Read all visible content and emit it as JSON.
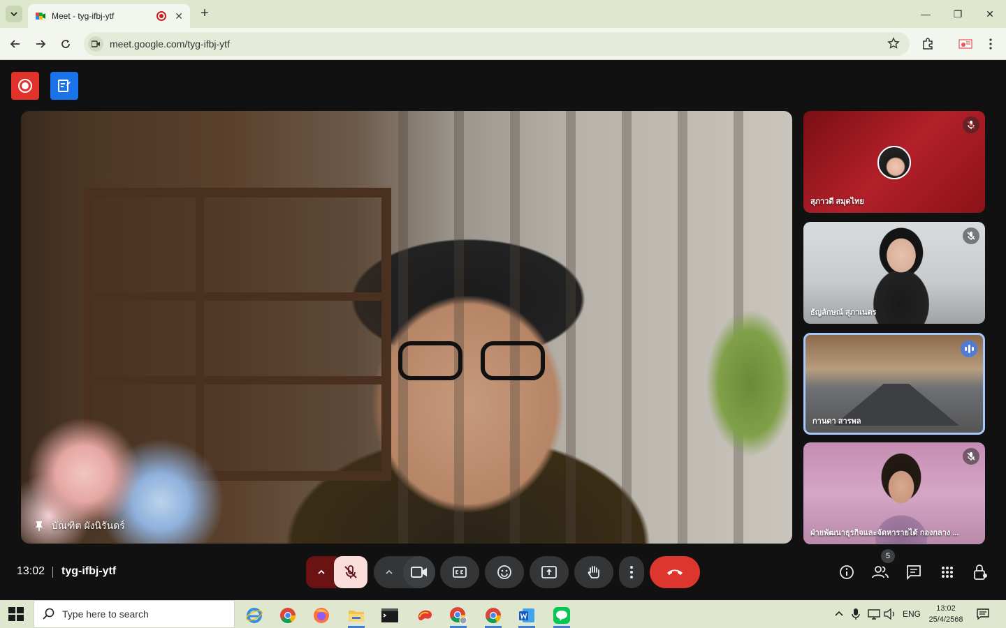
{
  "browser": {
    "tab_title": "Meet - tyg-ifbj-ytf",
    "tab_close": "✕",
    "new_tab": "+",
    "url": "meet.google.com/tyg-ifbj-ytf",
    "window_controls": {
      "minimize": "—",
      "maximize": "❐",
      "close": "✕"
    }
  },
  "meeting": {
    "time": "13:02",
    "code": "tyg-ifbj-ytf",
    "main_speaker": "บัณฑิต ผังนิรันดร์",
    "participants_count": "5",
    "tiles": [
      {
        "name": "สุภาวดี สมุดไทย",
        "state": "muted"
      },
      {
        "name": "ธัญลักษณ์ สุภาเนตร",
        "state": "muted"
      },
      {
        "name": "กานดา สารพล",
        "state": "speaking"
      },
      {
        "name": "ฝ่ายพัฒนาธุรกิจและจัดหารายได้ กองกลาง ...",
        "state": "muted"
      }
    ]
  },
  "taskbar": {
    "search_placeholder": "Type here to search",
    "lang": "ENG",
    "clock_time": "13:02",
    "clock_date": "25/4/2568"
  },
  "colors": {
    "record_button": "#e0312b",
    "notes_button": "#1a73e8",
    "end_call": "#dc362e",
    "mic_off_bg": "#f9dedc",
    "speaking_border": "#a8c7fa",
    "chrome_frame": "#dfe8cf"
  }
}
